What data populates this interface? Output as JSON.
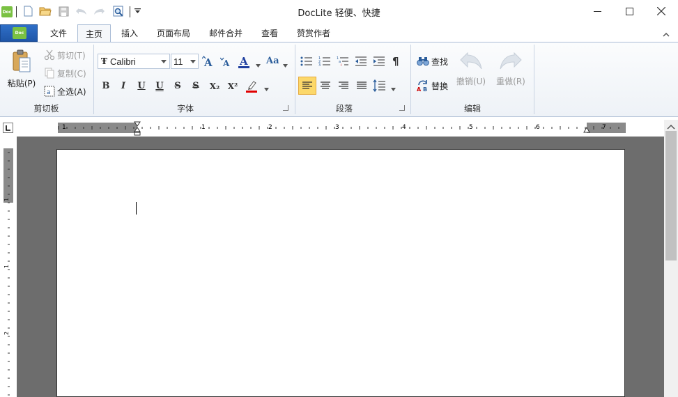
{
  "window": {
    "title": "DocLite  轻便、快捷",
    "controls": [
      "minimize",
      "maximize",
      "close"
    ]
  },
  "quick_access": {
    "app_icon": "Doc",
    "items": [
      "new-document-icon",
      "open-folder-icon",
      "save-icon",
      "undo-icon",
      "redo-icon",
      "print-preview-icon",
      "customize-dropdown-icon"
    ]
  },
  "app_button": {
    "label": "Doc"
  },
  "tabs": [
    {
      "label": "文件"
    },
    {
      "label": "主页",
      "active": true
    },
    {
      "label": "插入"
    },
    {
      "label": "页面布局"
    },
    {
      "label": "邮件合并"
    },
    {
      "label": "查看"
    },
    {
      "label": "赞赏作者"
    }
  ],
  "ribbon": {
    "clipboard": {
      "label": "剪切板",
      "paste": "粘贴(P)",
      "cut": "剪切(T)",
      "copy": "复制(C)",
      "select_all": "全选(A)"
    },
    "font": {
      "label": "字体",
      "font_name": "Calibri",
      "font_size": "11",
      "change_case": "Aa",
      "bold": "B",
      "italic": "I",
      "underline": "U",
      "double_underline": "U",
      "strike": "S",
      "double_strike": "S",
      "subscript": "X₂",
      "superscript": "X²"
    },
    "paragraph": {
      "label": "段落",
      "pilcrow": "¶"
    },
    "editing": {
      "label": "编辑",
      "find": "查找",
      "replace": "替换",
      "undo": "撤销(U)",
      "redo": "重做(R)"
    }
  },
  "ruler": {
    "numbers": [
      "1",
      "1",
      "2",
      "3",
      "4",
      "5",
      "6",
      "7"
    ],
    "vertical_numbers": [
      "1",
      "1",
      "2"
    ]
  },
  "colors": {
    "ribbon_bg": "#eef2f7",
    "doc_bg": "#6d6d6d",
    "app_button": "#2f6fc7",
    "doc_icon": "#7ac142",
    "font_color_bar": "#1f3f9f",
    "highlight_bar": "#e00000",
    "ruler_gray": "#8a8a8a"
  }
}
